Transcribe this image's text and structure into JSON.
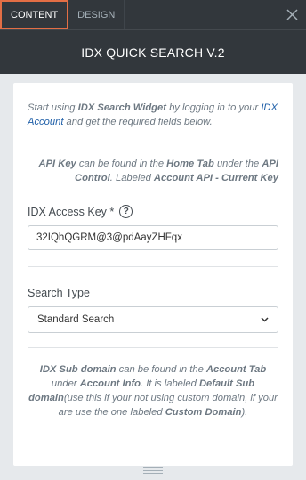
{
  "tabs": [
    {
      "label": "CONTENT",
      "active": true
    },
    {
      "label": "DESIGN",
      "active": false
    }
  ],
  "title": "IDX QUICK SEARCH V.2",
  "intro": {
    "t1": "Start using ",
    "b1": "IDX Search Widget",
    "t2": " by logging in to your ",
    "link": "IDX Account",
    "t3": " and get the required fields below."
  },
  "api_note": {
    "b1": "API Key",
    "t1": " can be found in the ",
    "b2": "Home Tab",
    "t2": " under the ",
    "b3": "API Control",
    "t3": ". Labeled ",
    "b4": "Account API - Current Key"
  },
  "access_key": {
    "label": "IDX Access Key *",
    "help_icon": "?",
    "value": "32IQhQGRM@3@pdAayZHFqx"
  },
  "search_type": {
    "label": "Search Type",
    "selected": "Standard Search"
  },
  "subdomain_note": {
    "b1": "IDX Sub domain",
    "t1": " can be found in the ",
    "b2": "Account Tab",
    "t2": " under ",
    "b3": "Account Info",
    "t3": ". It is labeled ",
    "b4": "Default Sub domain",
    "t4": "(use this if your not using custom domain, if your are use the one labeled ",
    "b5": "Custom Domain",
    "t5": ")."
  },
  "icons": {
    "close": "close-icon",
    "chevron": "chevron-down-icon",
    "resize": "resize-handle-icon"
  },
  "colors": {
    "header_bg": "#32373c",
    "active_tab_border": "#e36e45",
    "panel_bg": "#e6e9ec",
    "link": "#1f5fa8"
  }
}
